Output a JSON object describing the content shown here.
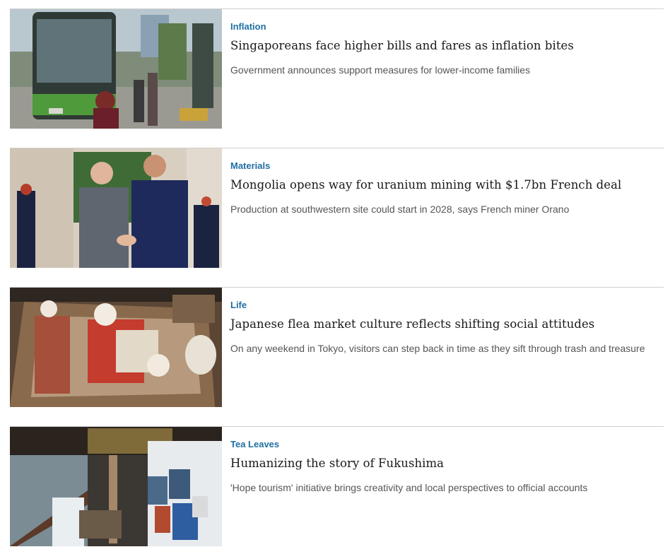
{
  "articles": [
    {
      "category": "Inflation",
      "headline": "Singaporeans face higher bills and fares as inflation bites",
      "summary": "Government announces support measures for lower-income families"
    },
    {
      "category": "Materials",
      "headline": "Mongolia opens way for uranium mining with $1.7bn French deal",
      "summary": "Production at southwestern site could start in 2028, says French miner Orano"
    },
    {
      "category": "Life",
      "headline": "Japanese flea market culture reflects shifting social attitudes",
      "summary": "On any weekend in Tokyo, visitors can step back in time as they sift through trash and treasure"
    },
    {
      "category": "Tea Leaves",
      "headline": "Humanizing the story of Fukushima",
      "summary": "'Hope tourism' initiative brings creativity and local perspectives to official accounts"
    }
  ],
  "colors": {
    "category": "#1f6fa3",
    "headline": "#1a1a1a",
    "summary": "#555555",
    "divider": "#cfcfcf"
  }
}
